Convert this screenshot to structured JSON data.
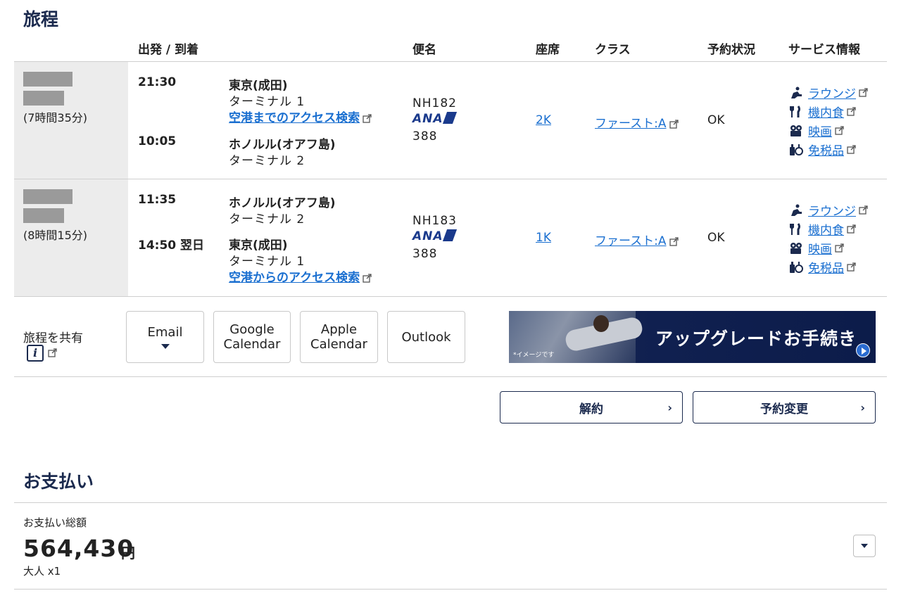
{
  "itinerary": {
    "title": "旅程",
    "columns": {
      "dep_arr": "出発 / 到着",
      "flight": "便名",
      "seat": "座席",
      "class": "クラス",
      "status": "予約状況",
      "services": "サービス情報"
    },
    "segments": [
      {
        "duration": "(7時間35分)",
        "dep_time": "21:30",
        "dep_airport": "東京(成田)",
        "dep_terminal": "ターミナル 1",
        "access_link": "空港までのアクセス検索",
        "arr_time": "10:05",
        "arr_airport": "ホノルル(オアフ島)",
        "arr_terminal": "ターミナル 2",
        "flight_no": "NH182",
        "airline_logo": "ANA",
        "aircraft": "388",
        "seat": "2K",
        "class": "ファースト:A",
        "status": "OK"
      },
      {
        "duration": "(8時間15分)",
        "dep_time": "11:35",
        "dep_airport": "ホノルル(オアフ島)",
        "dep_terminal": "ターミナル 2",
        "arr_time": "14:50 翌日",
        "arr_airport": "東京(成田)",
        "arr_terminal": "ターミナル 1",
        "access_link": "空港からのアクセス検索",
        "flight_no": "NH183",
        "airline_logo": "ANA",
        "aircraft": "388",
        "seat": "1K",
        "class": "ファースト:A",
        "status": "OK"
      }
    ],
    "services": [
      {
        "label": "ラウンジ",
        "icon": "lounge-seat-icon"
      },
      {
        "label": "機内食",
        "icon": "fork-knife-icon"
      },
      {
        "label": "映画",
        "icon": "film-camera-icon"
      },
      {
        "label": "免税品",
        "icon": "duty-free-bottle-icon"
      }
    ]
  },
  "share": {
    "label": "旅程を共有",
    "info_icon_text": "i",
    "buttons": {
      "email": "Email",
      "google_1": "Google",
      "google_2": "Calendar",
      "apple_1": "Apple",
      "apple_2": "Calendar",
      "outlook": "Outlook"
    }
  },
  "banner": {
    "title": "アップグレードお手続き",
    "note": "*イメージです"
  },
  "actions": {
    "cancel": "解約",
    "change": "予約変更",
    "chevron": "›"
  },
  "payment": {
    "title": "お支払い",
    "total_label": "お支払い総額",
    "amount": "564,430",
    "currency": "円",
    "passengers": "大人 x1"
  },
  "colors": {
    "heading": "#1b2a4e",
    "link": "#1a6fd0",
    "segment_bg": "#ececec",
    "ana_blue": "#1a3a8c"
  }
}
